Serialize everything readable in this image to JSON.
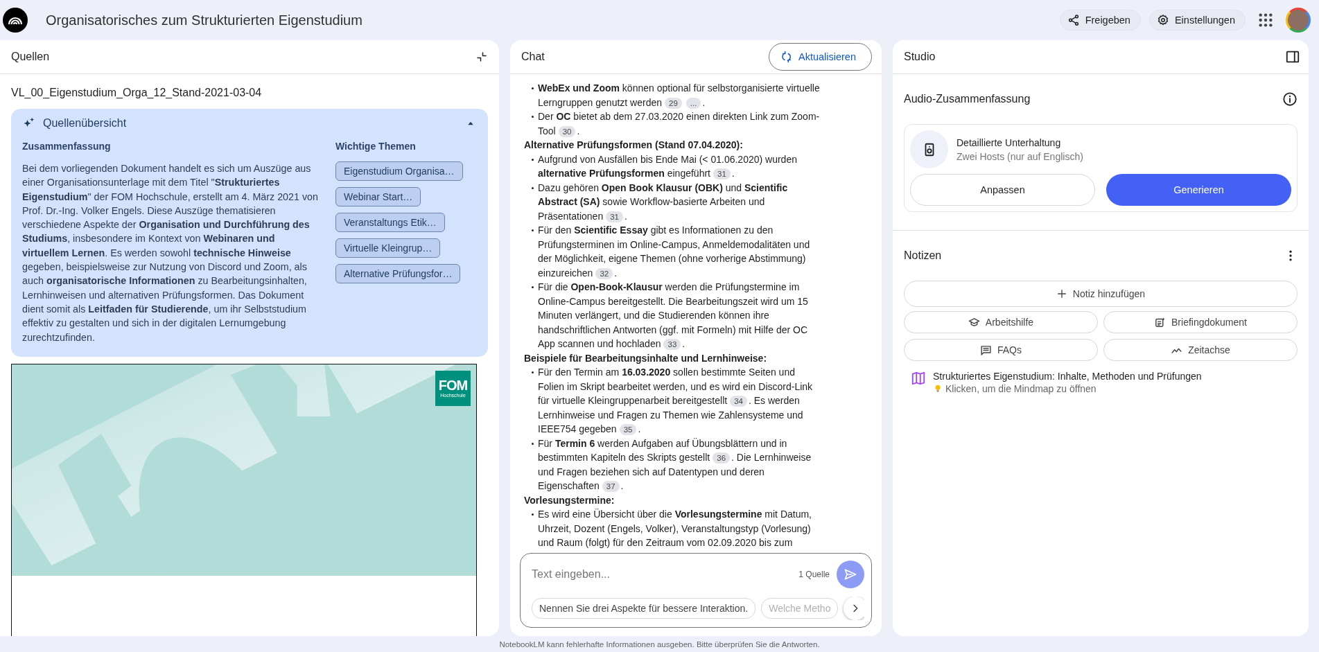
{
  "app": {
    "title": "Organisatorisches zum Strukturierten Eigenstudium"
  },
  "header_actions": [
    {
      "kind": "share",
      "label": "Freigeben"
    },
    {
      "kind": "settings",
      "label": "Einstellungen"
    }
  ],
  "sources": {
    "title": "Quellen",
    "document_name": "VL_00_Eigenstudium_Orga_12_Stand-2021-03-04",
    "overview": {
      "title": "Quellenübersicht",
      "expanded": true,
      "summary_heading": "Zusammenfassung",
      "summary": "Bei dem vorliegenden Dokument handelt es sich um Auszüge aus einer Organisationsunterlage mit dem Titel \"**Strukturiertes Eigenstudium**\" der FOM Hochschule, erstellt am 4. März 2021 von Prof. Dr.-Ing. Volker Engels. Diese Auszüge thematisieren verschiedene Aspekte der **Organisation und Durchführung des Studiums**, insbesondere im Kontext von **Webinaren und virtuellem Lernen**. Es werden sowohl **technische Hinweise** gegeben, beispielsweise zur Nutzung von Discord und Zoom, als auch **organisatorische Informationen** zu Bearbeitungsinhalten, Lernhinweisen und alternativen Prüfungsformen. Das Dokument dient somit als **Leitfaden für Studierende**, um ihr Selbststudium effektiv zu gestalten und sich in der digitalen Lernumgebung zurechtzufinden.",
      "topics_heading": "Wichtige Themen",
      "topics": [
        "Eigenstudium Organisa…",
        "Webinar Start…",
        "Veranstaltungs Etik…",
        "Virtuelle Kleingrup…",
        "Alternative Prüfungsfor…"
      ]
    },
    "preview": {
      "logo_title": "FOM",
      "logo_subtitle": "Hochschule"
    }
  },
  "chat": {
    "title": "Chat",
    "refresh_button": "Aktualisieren",
    "blocks": [
      {
        "kind": "bullet",
        "segments": [
          {
            "kind": "text",
            "text": "**WebEx und Zoom** können optional für selbstorganisierte virtuelle Lerngruppen genutzt werden"
          },
          {
            "kind": "cite",
            "text": "29"
          },
          {
            "kind": "cite",
            "text": "..."
          },
          {
            "kind": "text",
            "text": "."
          }
        ]
      },
      {
        "kind": "bullet",
        "segments": [
          {
            "kind": "text",
            "text": "Der **OC** bietet ab dem 27.03.2020 einen direkten Link zum Zoom-Tool"
          },
          {
            "kind": "cite",
            "text": "30"
          },
          {
            "kind": "text",
            "text": "."
          }
        ]
      },
      {
        "kind": "heading",
        "text": "Alternative Prüfungsformen (Stand 07.04.2020):"
      },
      {
        "kind": "bullet",
        "segments": [
          {
            "kind": "text",
            "text": "Aufgrund von Ausfällen bis Ende Mai (< 01.06.2020) wurden **alternative Prüfungsformen** eingeführt"
          },
          {
            "kind": "cite",
            "text": "31"
          },
          {
            "kind": "text",
            "text": "."
          }
        ]
      },
      {
        "kind": "bullet",
        "segments": [
          {
            "kind": "text",
            "text": "Dazu gehören **Open Book Klausur (OBK)** und **Scientific Abstract (SA)** sowie Workflow-basierte Arbeiten und Präsentationen"
          },
          {
            "kind": "cite",
            "text": "31"
          },
          {
            "kind": "text",
            "text": "."
          }
        ]
      },
      {
        "kind": "bullet",
        "segments": [
          {
            "kind": "text",
            "text": "Für den **Scientific Essay** gibt es Informationen zu den Prüfungsterminen im Online-Campus, Anmeldemodalitäten und der Möglichkeit, eigene Themen (ohne vorherige Abstimmung) einzureichen"
          },
          {
            "kind": "cite",
            "text": "32"
          },
          {
            "kind": "text",
            "text": "."
          }
        ]
      },
      {
        "kind": "bullet",
        "segments": [
          {
            "kind": "text",
            "text": "Für die **Open-Book-Klausur** werden die Prüfungstermine im Online-Campus bereitgestellt. Die Bearbeitungszeit wird um 15 Minuten verlängert, und die Studierenden können ihre handschriftlichen Antworten (ggf. mit Formeln) mit Hilfe der OC App scannen und hochladen"
          },
          {
            "kind": "cite",
            "text": "33"
          },
          {
            "kind": "text",
            "text": "."
          }
        ]
      },
      {
        "kind": "heading",
        "text": "Beispiele für Bearbeitungsinhalte und Lernhinweise:"
      },
      {
        "kind": "bullet",
        "segments": [
          {
            "kind": "text",
            "text": "Für den Termin am **16.03.2020** sollen bestimmte Seiten und Folien im Skript bearbeitet werden, und es wird ein Discord-Link für virtuelle Kleingruppenarbeit bereitgestellt"
          },
          {
            "kind": "cite",
            "text": "34"
          },
          {
            "kind": "text",
            "text": ". Es werden Lernhinweise und Fragen zu Themen wie Zahlensysteme und IEEE754 gegeben"
          },
          {
            "kind": "cite",
            "text": "35"
          },
          {
            "kind": "text",
            "text": "."
          }
        ]
      },
      {
        "kind": "bullet",
        "segments": [
          {
            "kind": "text",
            "text": "Für **Termin 6** werden Aufgaben auf Übungsblättern und in bestimmten Kapiteln des Skripts gestellt"
          },
          {
            "kind": "cite",
            "text": "36"
          },
          {
            "kind": "text",
            "text": ". Die Lernhinweise und Fragen beziehen sich auf Datentypen und deren Eigenschaften"
          },
          {
            "kind": "cite",
            "text": "37"
          },
          {
            "kind": "text",
            "text": "."
          }
        ]
      },
      {
        "kind": "heading",
        "text": "Vorlesungstermine:"
      },
      {
        "kind": "bullet",
        "segments": [
          {
            "kind": "text",
            "text": "Es wird eine Übersicht über die **Vorlesungstermine** mit Datum, Uhrzeit, Dozent (Engels, Volker), Veranstaltungstyp (Vorlesung) und Raum (folgt) für den Zeitraum vom 02.09.2020 bis zum"
          }
        ]
      }
    ],
    "input": {
      "placeholder": "Text eingeben...",
      "source_count": "1 Quelle"
    },
    "suggestions": [
      "Nennen Sie drei Aspekte für bessere Interaktion.",
      "Welche Metho"
    ]
  },
  "studio": {
    "title": "Studio",
    "audio": {
      "title": "Audio-Zusammenfassung",
      "card_title": "Detaillierte Unterhaltung",
      "card_subtitle": "Zwei Hosts (nur auf Englisch)",
      "customize_button": "Anpassen",
      "generate_button": "Generieren"
    },
    "notes": {
      "title": "Notizen",
      "add_button": "Notiz hinzufügen",
      "actions": [
        {
          "kind": "study",
          "label": "Arbeitshilfe"
        },
        {
          "kind": "briefing",
          "label": "Briefingdokument"
        },
        {
          "kind": "faq",
          "label": "FAQs"
        },
        {
          "kind": "timeline",
          "label": "Zeitachse"
        }
      ],
      "items": [
        {
          "title": "Strukturiertes Eigenstudium: Inhalte, Methoden und Prüfungen",
          "hint": "Klicken, um die Mindmap zu öffnen"
        }
      ]
    }
  },
  "footer": "NotebookLM kann fehlerhafte Informationen ausgeben. Bitte überprüfen Sie die Antworten."
}
